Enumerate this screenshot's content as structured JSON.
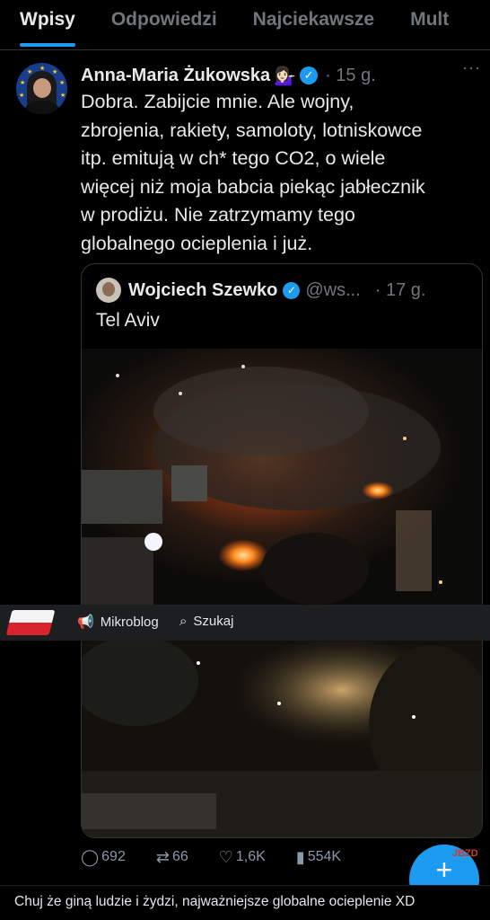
{
  "tabs": [
    {
      "label": "Wpisy",
      "active": true
    },
    {
      "label": "Odpowiedzi",
      "active": false
    },
    {
      "label": "Najciekawsze",
      "active": false
    },
    {
      "label": "Mult",
      "active": false
    }
  ],
  "post": {
    "author": "Anna-Maria Żukowska",
    "emoji": "💁🏻‍♀️",
    "verified": true,
    "time": "· 15 g.",
    "more": "···",
    "text": "Dobra. Zabijcie mnie. Ale wojny,\nzbrojenia, rakiety, samoloty, lotniskowce\nitp. emitują w ch* tego CO2, o wiele\nwięcej niż moja babcia piekąc jabłecznik\nw prodiżu. Nie zatrzymamy tego\nglobalnego ocieplenia i już."
  },
  "quote": {
    "author": "Wojciech Szewko",
    "handle": "@ws...",
    "time": "· 17 g.",
    "text": "Tel Aviv",
    "media_description_icon": "night-fire-video"
  },
  "actions": {
    "replies": "692",
    "reposts": "66",
    "likes": "1,6K",
    "views": "554K"
  },
  "wykop_bar": {
    "mikroblog_label": "Mikroblog",
    "search_label": "Szukaj"
  },
  "caption": "Chuj że giną ludzie i żydzi, najważniejsze globalne ocieplenie XD",
  "colors": {
    "accent": "#1d9bf0",
    "background": "#000000",
    "muted": "#71767b",
    "wykop_bar": "#1d1e20"
  }
}
